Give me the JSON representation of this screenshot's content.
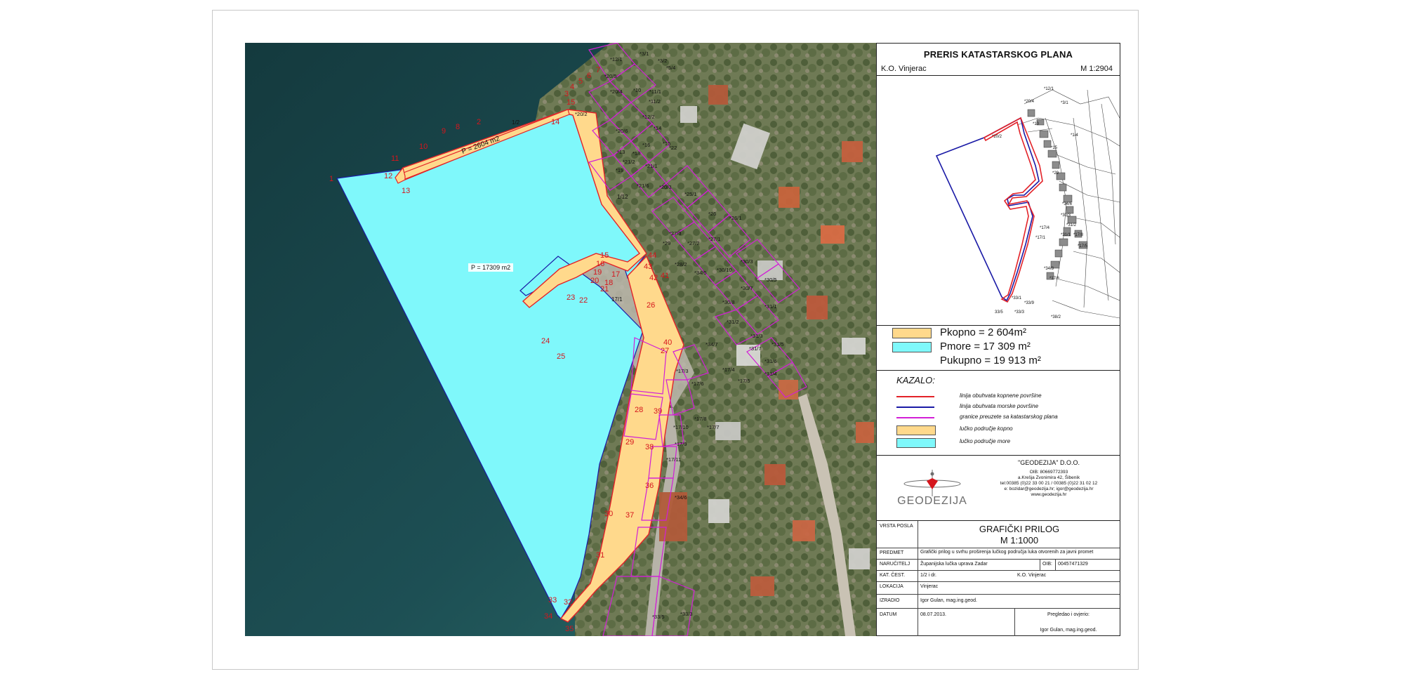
{
  "map": {
    "area_label_land": "P = 2604 m2",
    "area_label_sea": "P = 17309 m2",
    "parcel_label_12": "1/2",
    "parcel_label_1_12": "1/12",
    "parcel_label_17_1": "17/1",
    "point_numbers": [
      "1",
      "2",
      "8",
      "9",
      "10",
      "11",
      "12",
      "13",
      "14",
      "15",
      "15",
      "16",
      "19",
      "20",
      "21",
      "22",
      "23",
      "24",
      "25",
      "26",
      "27",
      "28",
      "29",
      "30",
      "31",
      "32",
      "33",
      "34",
      "35",
      "36",
      "37",
      "38",
      "39",
      "40",
      "41",
      "42",
      "43",
      "44",
      "17",
      "18",
      "3",
      "4",
      "5",
      "6",
      "7"
    ],
    "parcel_numbers": [
      "*12/1",
      "*3/1",
      "*3/2",
      "*5/4",
      "*20/5",
      "*20/4",
      "*10",
      "*11/1",
      "*11/2",
      "*20/2",
      "*12/2",
      "*14",
      "*20/6",
      "*15",
      "*16",
      "*18",
      "*21/2",
      "*21/1",
      "*19",
      "*22",
      "*13",
      "*21/6",
      "*20/3",
      "*25/1",
      "*26",
      "*26/1",
      "*27/1",
      "*27/2",
      "*27/3",
      "*28/2",
      "*29",
      "*34/5",
      "*30/10",
      "*30/3",
      "*30/5",
      "*30/7",
      "*30/8",
      "*31/1",
      "*31/2",
      "*31/3",
      "*31/5",
      "*31/6",
      "*31/4",
      "*31/7",
      "*34/7",
      "*17/3",
      "*17/4",
      "*17/5",
      "*17/6",
      "*17/8",
      "*17/10",
      "*17/7",
      "*17/11",
      "*17/9",
      "*33/5",
      "*33/3",
      "*34/6"
    ],
    "colors": {
      "land_fill": "#ffd98c",
      "sea_fill": "#7ff8fb",
      "land_border": "#e32228",
      "sea_border": "#1a1aa6",
      "parcel_border": "#d21fd6"
    }
  },
  "panel": {
    "title": "PRERIS KATASTARSKOG PLANA",
    "ko": "K.O. Vinjerac",
    "scale": "M 1:2904",
    "overview_labels": [
      "*20/4",
      "*20/2",
      "*12/1",
      "*3/1",
      "*10",
      "*1/4",
      "*15",
      "*29",
      "*34/6",
      "*30/3",
      "*31/2",
      "*31/1",
      "*17/4",
      "*17/1",
      "*17/8",
      "*17/5",
      "*33/9",
      "*33/1",
      "*33/3",
      "33/5",
      "*34/3",
      "*17/6",
      "*38/2"
    ],
    "areas": {
      "kopno": "Pkopno   =   2 604m²",
      "more": "Pmore    = 17 309 m²",
      "ukupno": "Pukupno = 19 913 m²"
    },
    "kazalo": {
      "title": "KAZALO:",
      "items": [
        {
          "label": "linija obuhvata kopnene površine",
          "color": "#e32228",
          "kind": "line"
        },
        {
          "label": "linija obuhvata morske površine",
          "color": "#1a1aa6",
          "kind": "line"
        },
        {
          "label": "granice preuzete sa katastarskog plana",
          "color": "#d21fd6",
          "kind": "line"
        },
        {
          "label": "lučko područje kopno",
          "color": "#ffd98c",
          "kind": "box"
        },
        {
          "label": "lučko područje more",
          "color": "#7ff8fb",
          "kind": "box"
        }
      ]
    },
    "company": {
      "logo_text": "GEODEZIJA",
      "name": "\"GEODEZIJA\" D.O.O.",
      "lines": [
        "OIB: 80669772393",
        "a.Krešja Zvonimira 42, Šibenik",
        "tel:00385 (0)22 33 00 21 / 00385 (0)22 31 02 12",
        "e: bozidar@geodezija.hr; igor@geodezija.hr",
        "www.geodezija.hr"
      ]
    },
    "titleblock": {
      "vrsta_label": "VRSTA POSLA",
      "vrsta_title": "GRAFIČKI PRILOG",
      "vrsta_scale": "M 1:1000",
      "predmet_label": "PREDMET",
      "predmet_value": "Grafički prilog u svrhu proširenja lučkog područja luka otvorenih za javni promet",
      "narucitelj_label": "NARUČITELJ",
      "narucitelj_value": "Županijska lučka uprava Zadar",
      "oib_label": "OIB:",
      "oib_value": "00457471329",
      "kat_cest_label": "KAT. ČEST.",
      "kat_cest_value": "1/2 i dr.",
      "ko_value": "K.O.  Vinjerac",
      "lokacija_label": "LOKACIJA",
      "lokacija_value": "Vinjerac",
      "izradio_label": "IZRADIO",
      "izradio_value": "Igor Gulan, mag.ing.geod.",
      "datum_label": "DATUM",
      "datum_value": "08.07.2013.",
      "potpis_label": "Pregledao i ovjerio:",
      "potpis_value": "Igor Gulan, mag.ing.geod."
    }
  }
}
